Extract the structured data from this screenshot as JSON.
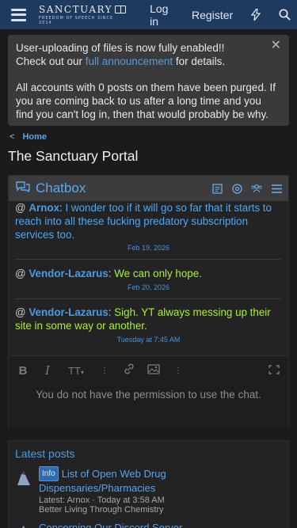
{
  "header": {
    "logo_main": "SANCTUARY",
    "logo_sub": "FREEDOM OF SPEECH SINCE 2014",
    "login": "Log in",
    "register": "Register"
  },
  "notice": {
    "line1": "User-uploading of files is now fully enabled!!",
    "line2_pre": "Check out our ",
    "line2_link": "full announcement",
    "line2_post": " for details.",
    "para2": "All accounts with 0 posts on them have been purged. If you are coming back to us after a long time and you find you can't log in, then that would probably be why."
  },
  "breadcrumb": {
    "home": "Home"
  },
  "page": {
    "title": "The Sanctuary Portal"
  },
  "chatbox": {
    "title": "Chatbox",
    "messages": [
      {
        "at": "@",
        "user": "Arnox",
        "text": "I wonder too if it will go so far that it starts to reach into all these fucking predatory subscription services too.",
        "time": "Feb 19, 2026"
      },
      {
        "at": "@",
        "user": "Vendor-Lazarus",
        "text": "We can only hope.",
        "time": "Feb 20, 2026"
      },
      {
        "at": "@",
        "user": "Vendor-Lazarus",
        "text": "Sigh. YT always messing up their site in some way or another.",
        "time": "Tuesday at 7:45 AM"
      }
    ],
    "no_permission": "You do not have the permission to use the chat."
  },
  "latest": {
    "heading": "Latest posts",
    "posts": [
      {
        "tag": "Info",
        "title": "List of Open Web Drug Dispensaries/Pharmacies",
        "meta": "Latest: Arnox · Today at 3:58 AM",
        "forum": "Better Living Through Chemistry"
      },
      {
        "title": "Concerning Our Discord Server"
      }
    ]
  },
  "colors": {
    "header_bg": "#1f3a5f",
    "accent": "#4a9ce0",
    "green": "#aaf02a"
  }
}
